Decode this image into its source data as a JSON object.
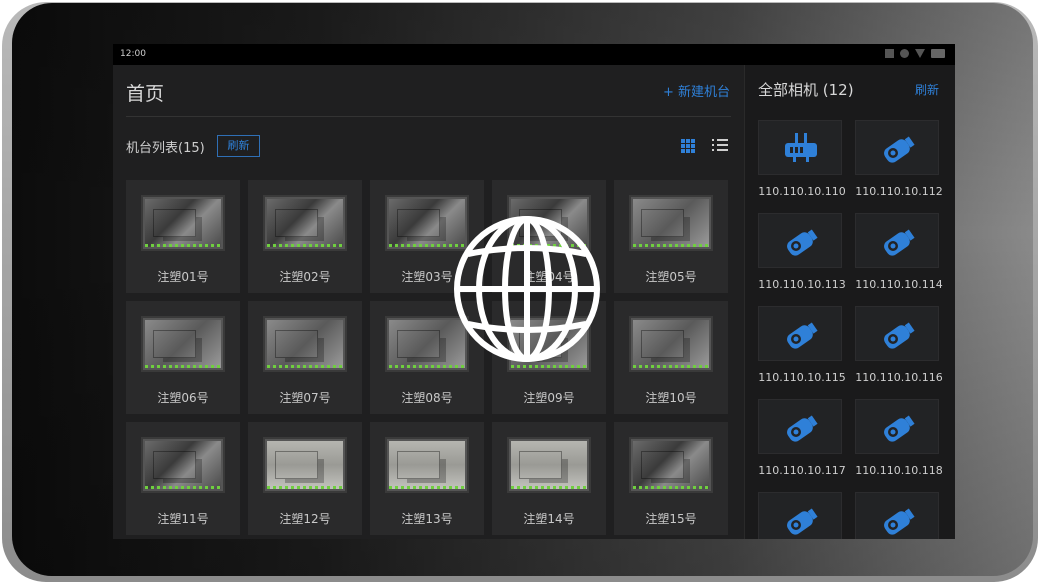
{
  "status_bar": {
    "time": "12:00"
  },
  "main": {
    "title": "首页",
    "new_machine_label": "+ 新建机台",
    "list_title": "机台列表(15)",
    "refresh_label": "刷新"
  },
  "machines": [
    {
      "name": "注塑01号",
      "tone": "dark"
    },
    {
      "name": "注塑02号",
      "tone": "dark"
    },
    {
      "name": "注塑03号",
      "tone": "dark"
    },
    {
      "name": "注塑04号",
      "tone": "dark"
    },
    {
      "name": "注塑05号",
      "tone": "mid"
    },
    {
      "name": "注塑06号",
      "tone": "mid"
    },
    {
      "name": "注塑07号",
      "tone": "mid"
    },
    {
      "name": "注塑08号",
      "tone": "mid"
    },
    {
      "name": "注塑09号",
      "tone": "mid"
    },
    {
      "name": "注塑10号",
      "tone": "mid"
    },
    {
      "name": "注塑11号",
      "tone": "dark"
    },
    {
      "name": "注塑12号",
      "tone": "light"
    },
    {
      "name": "注塑13号",
      "tone": "light"
    },
    {
      "name": "注塑14号",
      "tone": "light"
    },
    {
      "name": "注塑15号",
      "tone": "dark"
    }
  ],
  "cameras_panel": {
    "title": "全部相机 (12)",
    "refresh_label": "刷新",
    "cameras": [
      {
        "ip": "110.110.10.110",
        "icon": "network-device-icon"
      },
      {
        "ip": "110.110.10.112",
        "icon": "camera-icon"
      },
      {
        "ip": "110.110.10.113",
        "icon": "camera-icon"
      },
      {
        "ip": "110.110.10.114",
        "icon": "camera-icon"
      },
      {
        "ip": "110.110.10.115",
        "icon": "camera-icon"
      },
      {
        "ip": "110.110.10.116",
        "icon": "camera-icon"
      },
      {
        "ip": "110.110.10.117",
        "icon": "camera-icon"
      },
      {
        "ip": "110.110.10.118",
        "icon": "camera-icon"
      },
      {
        "ip": "",
        "icon": "camera-icon"
      },
      {
        "ip": "",
        "icon": "camera-icon"
      }
    ]
  },
  "colors": {
    "accent": "#2f80d8",
    "background": "#1f1f20",
    "card": "#2a2a2b"
  },
  "overlay": {
    "icon": "globe-icon"
  }
}
